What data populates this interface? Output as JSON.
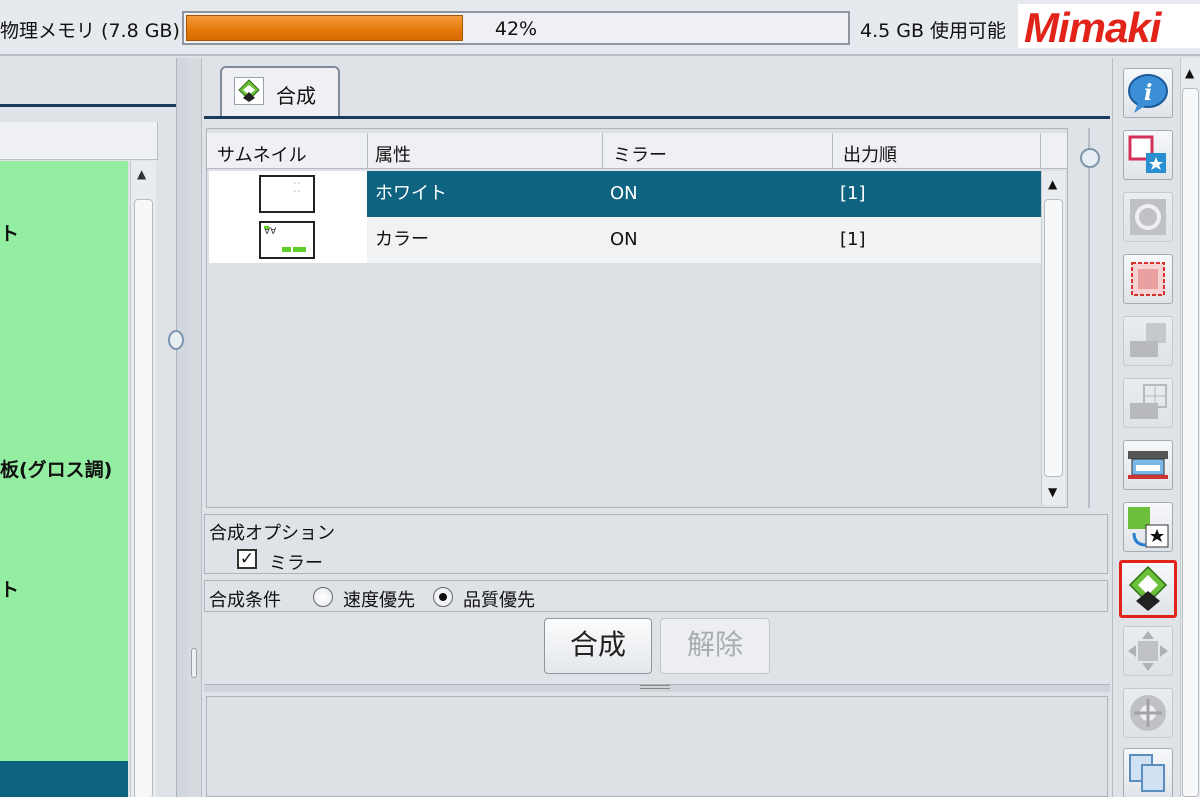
{
  "topbar": {
    "memory_label": "物理メモリ (7.8 GB)",
    "memory_percent": "42%",
    "memory_fraction": 0.42,
    "available": "4.5 GB 使用可能",
    "logo": "Mimaki"
  },
  "left_panel": {
    "items": [
      "ト",
      "板(グロス調)",
      "ト"
    ]
  },
  "tab": {
    "label": "合成",
    "icon": "compose-icon"
  },
  "grid": {
    "columns": [
      "サムネイル",
      "属性",
      "ミラー",
      "出力順"
    ],
    "rows": [
      {
        "attribute": "ホワイト",
        "mirror": "ON",
        "order": "[1]",
        "selected": true
      },
      {
        "attribute": "カラー",
        "mirror": "ON",
        "order": "[1]",
        "selected": false
      }
    ]
  },
  "options": {
    "title": "合成オプション",
    "mirror_label": "ミラー",
    "mirror_checked": true
  },
  "conditions": {
    "label": "合成条件",
    "options": [
      "速度優先",
      "品質優先"
    ],
    "selected": "品質優先"
  },
  "buttons": {
    "compose": "合成",
    "release": "解除"
  },
  "toolbar": {
    "tools": [
      "info-icon",
      "layout-icon",
      "quality-icon",
      "crop-icon",
      "print-setting-icon",
      "tile-icon",
      "printer-icon",
      "replace-icon",
      "compose-icon",
      "move-icon",
      "rotate-icon",
      "copy-icon"
    ],
    "active": "compose-icon"
  },
  "colors": {
    "selected_row": "#0e6380",
    "left_list": "#94eea2",
    "progress": "#e4780a",
    "active_border": "#e2231a",
    "logo": "#e2231a"
  },
  "checkmark": "✓",
  "arrows": {
    "up": "▲",
    "down": "▼"
  }
}
